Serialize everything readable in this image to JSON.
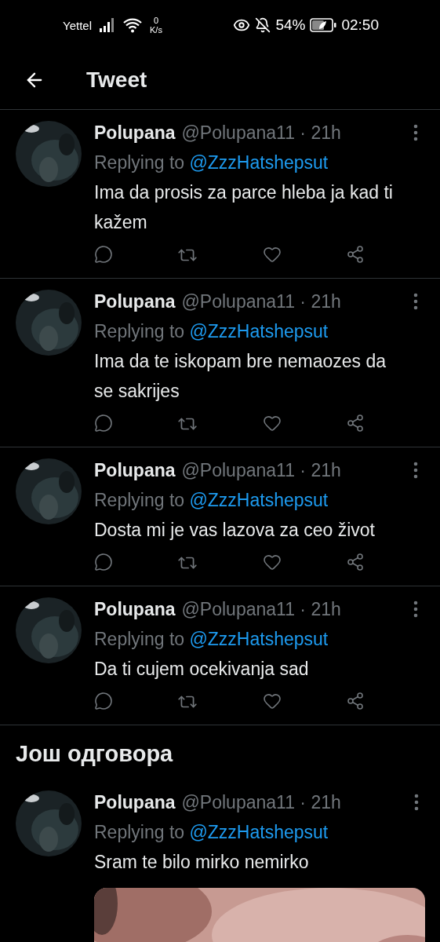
{
  "status_bar": {
    "carrier": "Yettel",
    "net_speed_value": "0",
    "net_speed_unit": "K/s",
    "battery": "54%",
    "time": "02:50"
  },
  "header": {
    "title": "Tweet"
  },
  "tweets": [
    {
      "name": "Polupana",
      "handle": "@Polupana11 · 21h",
      "replying_label": "Replying to",
      "replying_to": "@ZzzHatshepsut",
      "text": "Ima da prosis za parce hleba ja kad ti kažem"
    },
    {
      "name": "Polupana",
      "handle": "@Polupana11 · 21h",
      "replying_label": "Replying to",
      "replying_to": "@ZzzHatshepsut",
      "text": "Ima da te iskopam bre nemaozes da se sakrijes"
    },
    {
      "name": "Polupana",
      "handle": "@Polupana11 · 21h",
      "replying_label": "Replying to",
      "replying_to": "@ZzzHatshepsut",
      "text": "Dosta mi je vas lazova za ceo život"
    },
    {
      "name": "Polupana",
      "handle": "@Polupana11 · 21h",
      "replying_label": "Replying to",
      "replying_to": "@ZzzHatshepsut",
      "text": "Da ti cujem ocekivanja sad"
    }
  ],
  "section_title": "Још одговора",
  "more_tweets": [
    {
      "name": "Polupana",
      "handle": "@Polupana11 · 21h",
      "replying_label": "Replying to",
      "replying_to": "@ZzzHatshepsut",
      "text": "Sram te bilo mirko nemirko"
    }
  ]
}
